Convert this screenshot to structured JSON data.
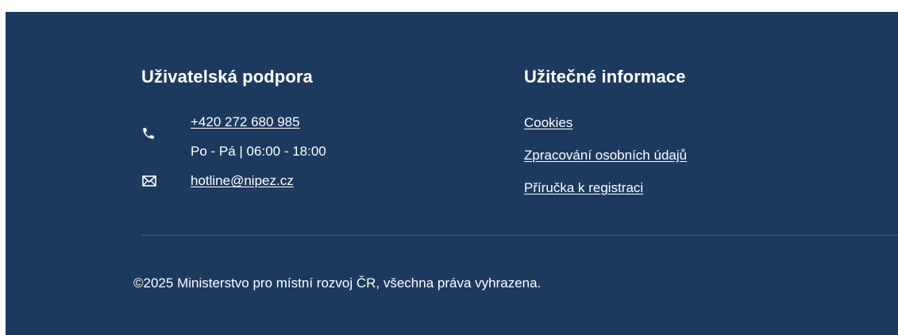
{
  "support": {
    "title": "Uživatelská podpora",
    "phone": "+420 272 680 985",
    "hours": "Po - Pá | 06:00 - 18:00",
    "email": "hotline@nipez.cz",
    "phone_icon": "phone-icon",
    "email_icon": "envelope-icon"
  },
  "info": {
    "title": "Užitečné informace",
    "links": [
      "Cookies",
      "Zpracování osobních údajů",
      "Příručka k registraci"
    ]
  },
  "copyright": "©2025 Ministerstvo pro místní rozvoj ČR, všechna práva vyhrazena.",
  "colors": {
    "background": "#1d3a5e",
    "divider": "#2f6496",
    "text": "#ffffff"
  }
}
